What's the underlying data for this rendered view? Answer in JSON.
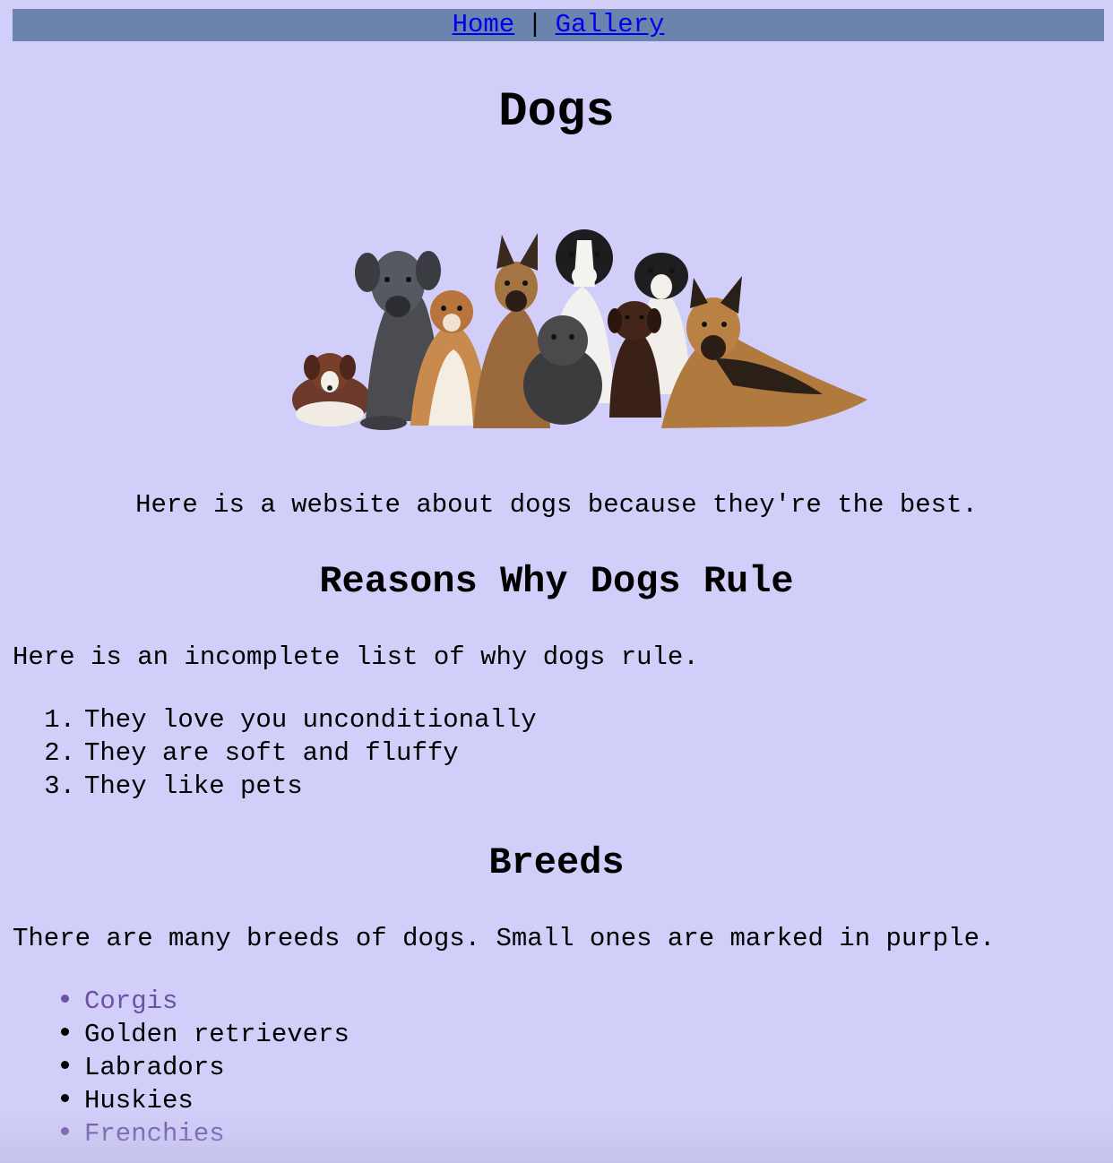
{
  "nav": {
    "home": "Home",
    "separator": "|",
    "gallery": "Gallery"
  },
  "page": {
    "title": "Dogs",
    "intro": "Here is a website about dogs because they're the best."
  },
  "hero_image": {
    "icon": "group-of-dogs-photo"
  },
  "reasons": {
    "heading": "Reasons Why Dogs Rule",
    "text": "Here is an incomplete list of why dogs rule.",
    "items": [
      {
        "num": "1.",
        "label": "They love you unconditionally"
      },
      {
        "num": "2.",
        "label": "They are soft and fluffy"
      },
      {
        "num": "3.",
        "label": "They like pets"
      }
    ]
  },
  "breeds": {
    "heading": "Breeds",
    "text": "There are many breeds of dogs. Small ones are marked in purple.",
    "items": [
      {
        "label": "Corgis",
        "small": true
      },
      {
        "label": "Golden retrievers",
        "small": false
      },
      {
        "label": "Labradors",
        "small": false
      },
      {
        "label": "Huskies",
        "small": false
      },
      {
        "label": "Frenchies",
        "small": true
      }
    ]
  },
  "colors": {
    "background": "#d1cff9",
    "nav_bar": "#6b84ad",
    "link": "#0000ee",
    "small_breed": "#6b52a3"
  }
}
